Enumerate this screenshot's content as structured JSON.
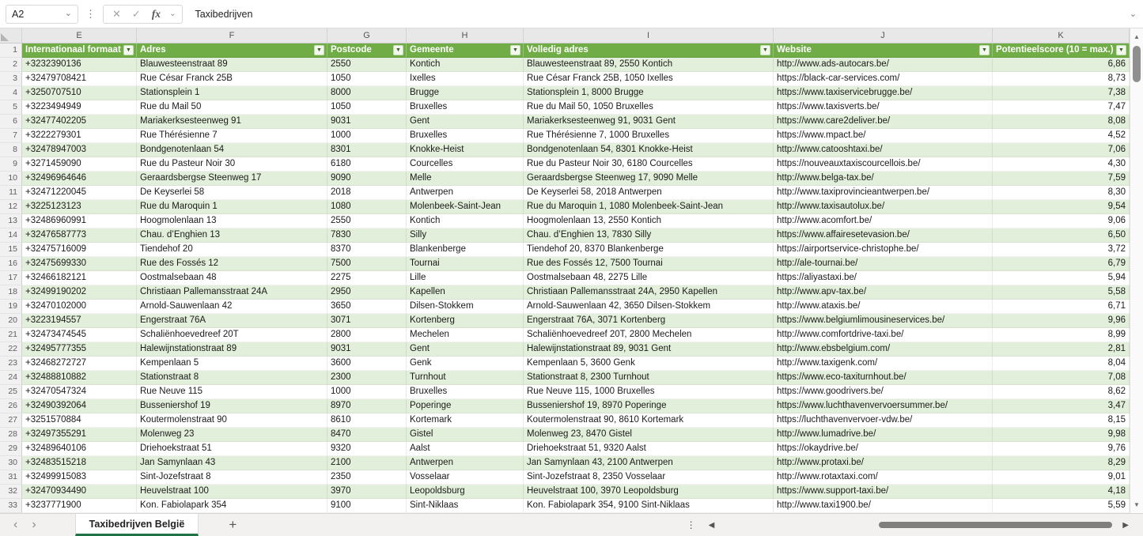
{
  "formula_bar": {
    "cell_reference": "A2",
    "formula_text": "Taxibedrijven",
    "fx_label": "fx"
  },
  "icons": {
    "dropdown_chevron": "⌄",
    "kebab": "⋮",
    "cancel": "✕",
    "confirm": "✓",
    "filter_arrow": "▼",
    "tab_prev": "‹",
    "tab_next": "›",
    "add_sheet": "+",
    "scroll_left": "◀",
    "scroll_right": "▶",
    "scroll_up": "▲",
    "scroll_down": "▼"
  },
  "sheet": {
    "column_letters": [
      "E",
      "F",
      "G",
      "H",
      "I",
      "J",
      "K"
    ],
    "table": {
      "headers": [
        "Internationaal formaat",
        "Adres",
        "Postcode",
        "Gemeente",
        "Volledig adres",
        "Website",
        "Potentieelscore (10 = max.)"
      ],
      "rows": [
        {
          "n": 2,
          "c": [
            "+3232390136",
            "Blauwesteenstraat 89",
            "2550",
            "Kontich",
            "Blauwesteenstraat 89, 2550 Kontich",
            "http://www.ads-autocars.be/",
            "6,86"
          ]
        },
        {
          "n": 3,
          "c": [
            "+32479708421",
            "Rue César Franck 25B",
            "1050",
            "Ixelles",
            "Rue César Franck 25B, 1050 Ixelles",
            "https://black-car-services.com/",
            "8,73"
          ]
        },
        {
          "n": 4,
          "c": [
            "+3250707510",
            "Stationsplein 1",
            "8000",
            "Brugge",
            "Stationsplein 1, 8000 Brugge",
            "https://www.taxiservicebrugge.be/",
            "7,38"
          ]
        },
        {
          "n": 5,
          "c": [
            "+3223494949",
            "Rue du Mail 50",
            "1050",
            "Bruxelles",
            "Rue du Mail 50, 1050 Bruxelles",
            "https://www.taxisverts.be/",
            "7,47"
          ]
        },
        {
          "n": 6,
          "c": [
            "+32477402205",
            "Mariakerksesteenweg 91",
            "9031",
            "Gent",
            "Mariakerksesteenweg 91, 9031 Gent",
            "https://www.care2deliver.be/",
            "8,08"
          ]
        },
        {
          "n": 7,
          "c": [
            "+3222279301",
            "Rue Thérésienne 7",
            "1000",
            "Bruxelles",
            "Rue Thérésienne 7, 1000 Bruxelles",
            "https://www.mpact.be/",
            "4,52"
          ]
        },
        {
          "n": 8,
          "c": [
            "+32478947003",
            "Bondgenotenlaan 54",
            "8301",
            "Knokke-Heist",
            "Bondgenotenlaan 54, 8301 Knokke-Heist",
            "http://www.catooshtaxi.be/",
            "7,06"
          ]
        },
        {
          "n": 9,
          "c": [
            "+3271459090",
            "Rue du Pasteur Noir 30",
            "6180",
            "Courcelles",
            "Rue du Pasteur Noir 30, 6180 Courcelles",
            "https://nouveauxtaxiscourcellois.be/",
            "4,30"
          ]
        },
        {
          "n": 10,
          "c": [
            "+32496964646",
            "Geraardsbergse Steenweg 17",
            "9090",
            "Melle",
            "Geraardsbergse Steenweg 17, 9090 Melle",
            "http://www.belga-tax.be/",
            "7,59"
          ]
        },
        {
          "n": 11,
          "c": [
            "+32471220045",
            "De Keyserlei 58",
            "2018",
            "Antwerpen",
            "De Keyserlei 58, 2018 Antwerpen",
            "http://www.taxiprovincieantwerpen.be/",
            "8,30"
          ]
        },
        {
          "n": 12,
          "c": [
            "+3225123123",
            "Rue du Maroquin 1",
            "1080",
            "Molenbeek-Saint-Jean",
            "Rue du Maroquin 1, 1080 Molenbeek-Saint-Jean",
            "http://www.taxisautolux.be/",
            "9,54"
          ]
        },
        {
          "n": 13,
          "c": [
            "+32486960991",
            "Hoogmolenlaan 13",
            "2550",
            "Kontich",
            "Hoogmolenlaan 13, 2550 Kontich",
            "http://www.acomfort.be/",
            "9,06"
          ]
        },
        {
          "n": 14,
          "c": [
            "+32476587773",
            "Chau. d’Enghien 13",
            "7830",
            "Silly",
            "Chau. d’Enghien 13, 7830 Silly",
            "https://www.affairesetevasion.be/",
            "6,50"
          ]
        },
        {
          "n": 15,
          "c": [
            "+32475716009",
            "Tiendehof 20",
            "8370",
            "Blankenberge",
            "Tiendehof 20, 8370 Blankenberge",
            "https://airportservice-christophe.be/",
            "3,72"
          ]
        },
        {
          "n": 16,
          "c": [
            "+32475699330",
            "Rue des Fossés 12",
            "7500",
            "Tournai",
            "Rue des Fossés 12, 7500 Tournai",
            "http://ale-tournai.be/",
            "6,79"
          ]
        },
        {
          "n": 17,
          "c": [
            "+32466182121",
            "Oostmalsebaan 48",
            "2275",
            "Lille",
            "Oostmalsebaan 48, 2275 Lille",
            "https://aliyastaxi.be/",
            "5,94"
          ]
        },
        {
          "n": 18,
          "c": [
            "+32499190202",
            "Christiaan Pallemansstraat 24A",
            "2950",
            "Kapellen",
            "Christiaan Pallemansstraat 24A, 2950 Kapellen",
            "http://www.apv-tax.be/",
            "5,58"
          ]
        },
        {
          "n": 19,
          "c": [
            "+32470102000",
            "Arnold-Sauwenlaan 42",
            "3650",
            "Dilsen-Stokkem",
            "Arnold-Sauwenlaan 42, 3650 Dilsen-Stokkem",
            "http://www.ataxis.be/",
            "6,71"
          ]
        },
        {
          "n": 20,
          "c": [
            "+3223194557",
            "Engerstraat 76A",
            "3071",
            "Kortenberg",
            "Engerstraat 76A, 3071 Kortenberg",
            "https://www.belgiumlimousineservices.be/",
            "9,96"
          ]
        },
        {
          "n": 21,
          "c": [
            "+32473474545",
            "Schaliënhoevedreef 20T",
            "2800",
            "Mechelen",
            "Schaliënhoevedreef 20T, 2800 Mechelen",
            "http://www.comfortdrive-taxi.be/",
            "8,99"
          ]
        },
        {
          "n": 22,
          "c": [
            "+32495777355",
            "Halewijnstationstraat 89",
            "9031",
            "Gent",
            "Halewijnstationstraat 89, 9031 Gent",
            "http://www.ebsbelgium.com/",
            "2,81"
          ]
        },
        {
          "n": 23,
          "c": [
            "+32468272727",
            "Kempenlaan 5",
            "3600",
            "Genk",
            "Kempenlaan 5, 3600 Genk",
            "http://www.taxigenk.com/",
            "8,04"
          ]
        },
        {
          "n": 24,
          "c": [
            "+32488810882",
            "Stationstraat 8",
            "2300",
            "Turnhout",
            "Stationstraat 8, 2300 Turnhout",
            "https://www.eco-taxiturnhout.be/",
            "7,08"
          ]
        },
        {
          "n": 25,
          "c": [
            "+32470547324",
            "Rue Neuve 115",
            "1000",
            "Bruxelles",
            "Rue Neuve 115, 1000 Bruxelles",
            "https://www.goodrivers.be/",
            "8,62"
          ]
        },
        {
          "n": 26,
          "c": [
            "+32490392064",
            "Busseniershof 19",
            "8970",
            "Poperinge",
            "Busseniershof 19, 8970 Poperinge",
            "https://www.luchthavenvervoersummer.be/",
            "3,47"
          ]
        },
        {
          "n": 27,
          "c": [
            "+3251570884",
            "Koutermolenstraat 90",
            "8610",
            "Kortemark",
            "Koutermolenstraat 90, 8610 Kortemark",
            "https://luchthavenvervoer-vdw.be/",
            "8,15"
          ]
        },
        {
          "n": 28,
          "c": [
            "+32497355291",
            "Molenweg 23",
            "8470",
            "Gistel",
            "Molenweg 23, 8470 Gistel",
            "http://www.lumadrive.be/",
            "9,98"
          ]
        },
        {
          "n": 29,
          "c": [
            "+32489640106",
            "Driehoekstraat 51",
            "9320",
            "Aalst",
            "Driehoekstraat 51, 9320 Aalst",
            "https://okaydrive.be/",
            "9,76"
          ]
        },
        {
          "n": 30,
          "c": [
            "+32483515218",
            "Jan Samynlaan 43",
            "2100",
            "Antwerpen",
            "Jan Samynlaan 43, 2100 Antwerpen",
            "http://www.protaxi.be/",
            "8,29"
          ]
        },
        {
          "n": 31,
          "c": [
            "+32499915083",
            "Sint-Jozefstraat 8",
            "2350",
            "Vosselaar",
            "Sint-Jozefstraat 8, 2350 Vosselaar",
            "http://www.rotaxtaxi.com/",
            "9,01"
          ]
        },
        {
          "n": 32,
          "c": [
            "+32470934490",
            "Heuvelstraat 100",
            "3970",
            "Leopoldsburg",
            "Heuvelstraat 100, 3970 Leopoldsburg",
            "https://www.support-taxi.be/",
            "4,18"
          ]
        },
        {
          "n": 33,
          "c": [
            "+3237771900",
            "Kon. Fabiolapark 354",
            "9100",
            "Sint-Niklaas",
            "Kon. Fabiolapark 354, 9100 Sint-Niklaas",
            "http://www.taxi1900.be/",
            "5,59"
          ]
        }
      ]
    }
  },
  "sheet_bar": {
    "active_tab": "Taxibedrijven België"
  },
  "colors": {
    "table_header_green": "#70AD47",
    "row_band_green": "#E2EFDA",
    "active_tab_underline": "#217346"
  }
}
